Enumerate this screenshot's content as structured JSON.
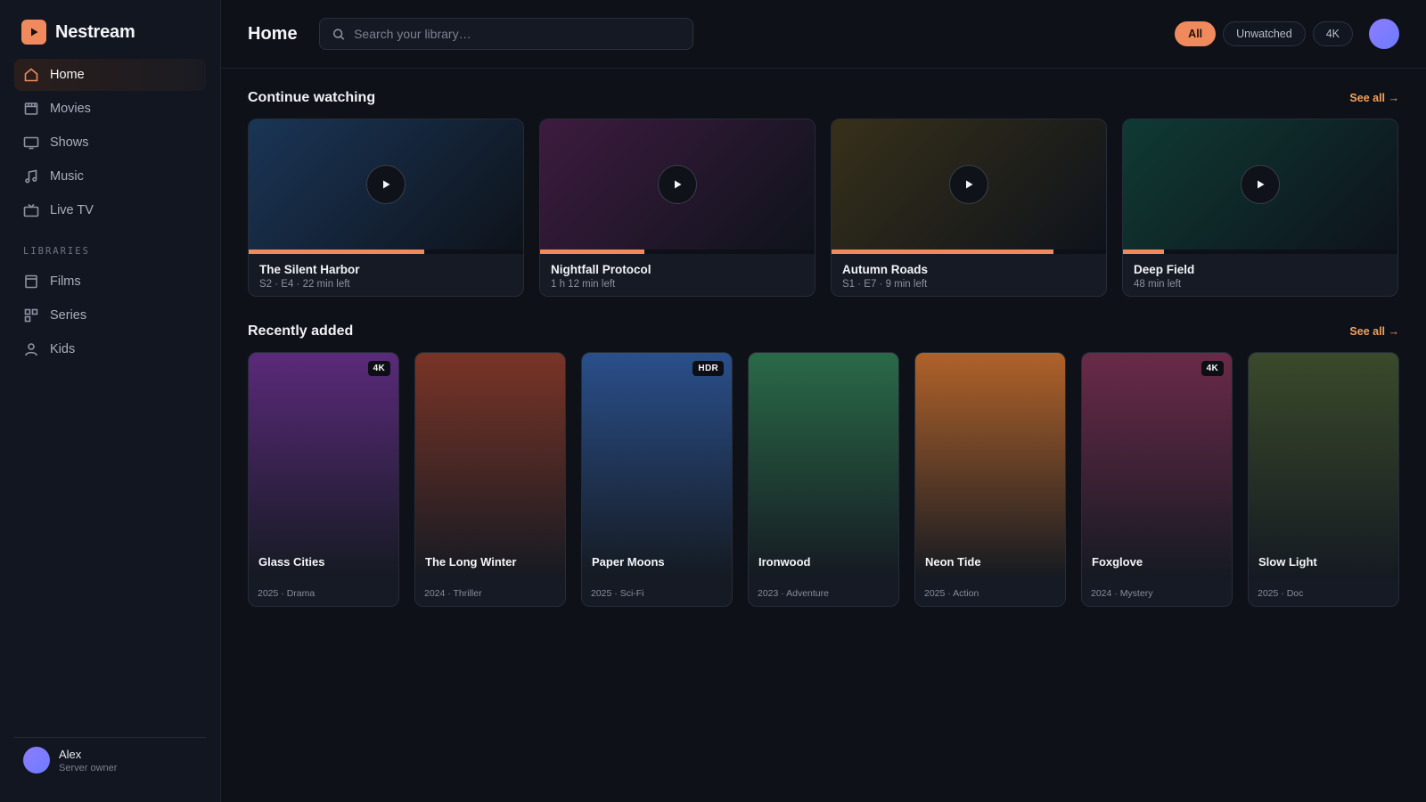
{
  "brand": {
    "name": "Nestream",
    "accent": "#f08a5d"
  },
  "sidebar": {
    "nav": [
      {
        "label": "Home",
        "icon": "home-icon",
        "active": true
      },
      {
        "label": "Movies",
        "icon": "film-icon"
      },
      {
        "label": "Shows",
        "icon": "monitor-icon"
      },
      {
        "label": "Music",
        "icon": "music-icon"
      },
      {
        "label": "Live TV",
        "icon": "tv-icon"
      }
    ],
    "libraries_label": "LIBRARIES",
    "libraries": [
      {
        "label": "Films",
        "icon": "archive-icon"
      },
      {
        "label": "Series",
        "icon": "grid-icon"
      },
      {
        "label": "Kids",
        "icon": "user-icon"
      }
    ],
    "user": {
      "name": "Alex",
      "role": "Server owner"
    }
  },
  "header": {
    "title": "Home",
    "search_placeholder": "Search your library…",
    "filters": [
      {
        "label": "All",
        "active": true
      },
      {
        "label": "Unwatched"
      },
      {
        "label": "4K"
      }
    ]
  },
  "continue_watching": {
    "title": "Continue watching",
    "see_all": "See all →",
    "items": [
      {
        "title": "The Silent Harbor",
        "meta": "S2 · E4 · 22 min left",
        "progress": 0.64,
        "color": "#1a3556"
      },
      {
        "title": "Nightfall Protocol",
        "meta": "1 h 12 min left",
        "progress": 0.38,
        "color": "#3d1b3f"
      },
      {
        "title": "Autumn Roads",
        "meta": "S1 · E7 · 9 min left",
        "progress": 0.81,
        "color": "#37301a"
      },
      {
        "title": "Deep Field",
        "meta": "48 min left",
        "progress": 0.15,
        "color": "#0f3a33"
      }
    ]
  },
  "recently_added": {
    "title": "Recently added",
    "see_all": "See all →",
    "items": [
      {
        "title": "Glass Cities",
        "meta": "2025 · Drama",
        "badge": "4K",
        "color": "#5a2a7a"
      },
      {
        "title": "The Long Winter",
        "meta": "2024 · Thriller",
        "badge": "",
        "color": "#7a3427"
      },
      {
        "title": "Paper Moons",
        "meta": "2025 · Sci-Fi",
        "badge": "HDR",
        "color": "#2a4f8a"
      },
      {
        "title": "Ironwood",
        "meta": "2023 · Adventure",
        "badge": "",
        "color": "#2a6a48"
      },
      {
        "title": "Neon Tide",
        "meta": "2025 · Action",
        "badge": "",
        "color": "#b0622a"
      },
      {
        "title": "Foxglove",
        "meta": "2024 · Mystery",
        "badge": "4K",
        "color": "#6a2a48"
      },
      {
        "title": "Slow Light",
        "meta": "2025 · Doc",
        "badge": "",
        "color": "#3a4a2a"
      }
    ]
  }
}
